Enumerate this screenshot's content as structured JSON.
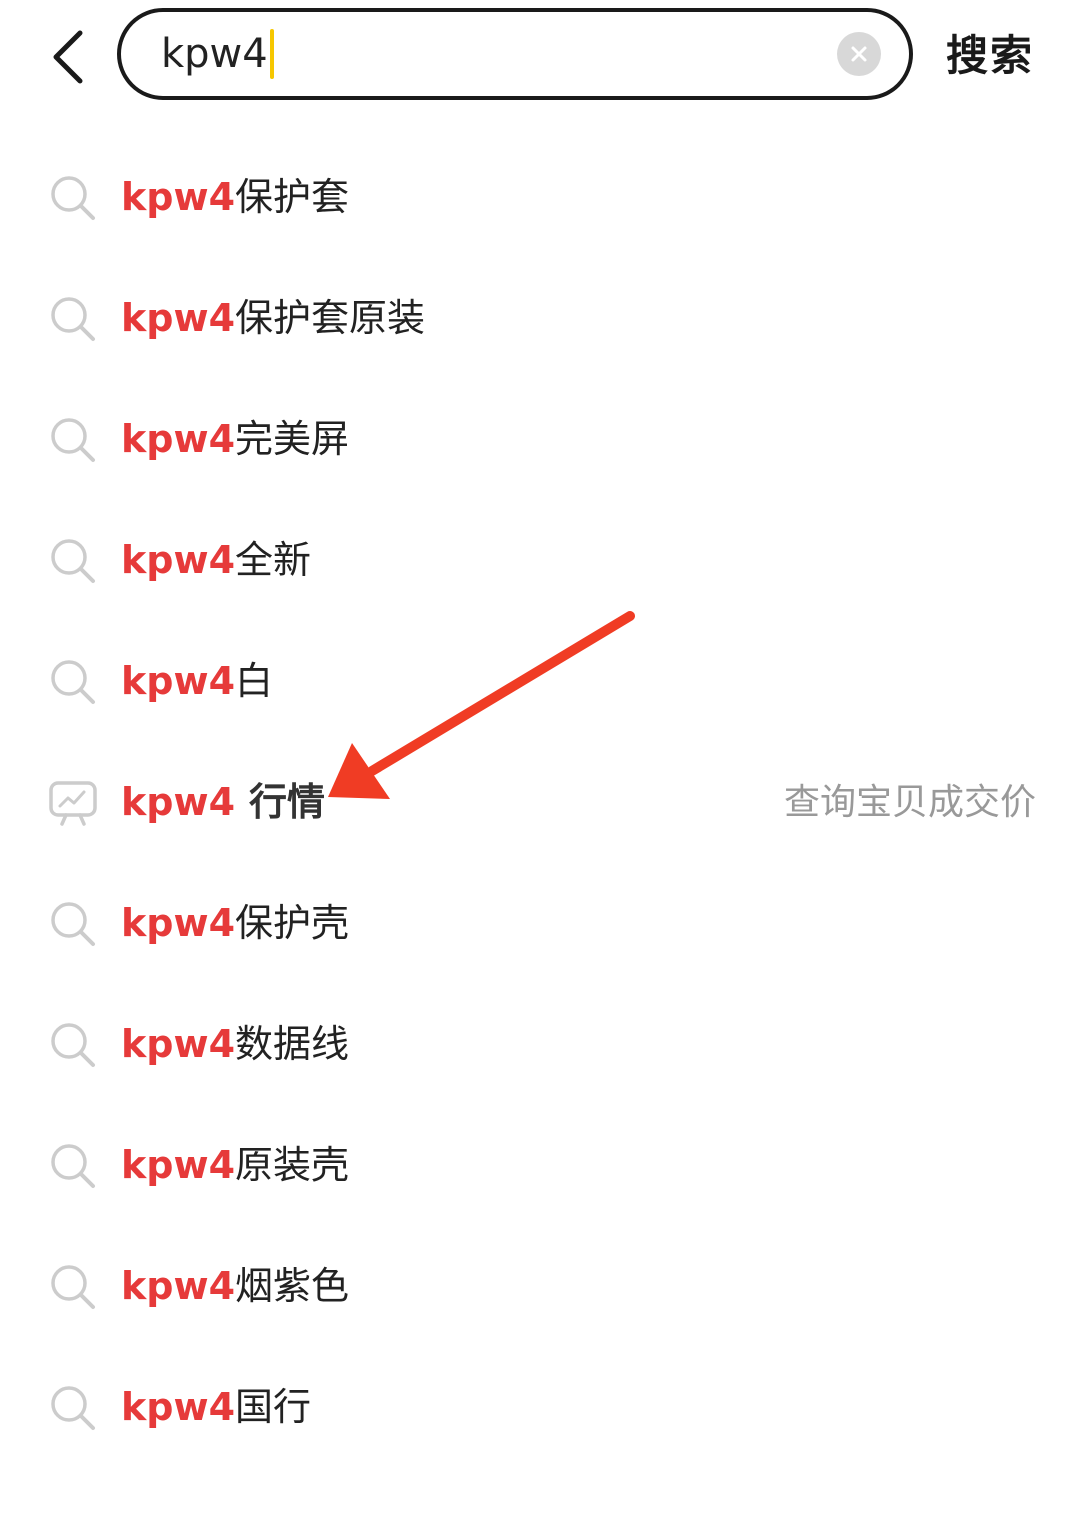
{
  "search": {
    "query": "kpw4",
    "submit_label": "搜索"
  },
  "suggestions": [
    {
      "prefix": "kpw4",
      "suffix": "保护套"
    },
    {
      "prefix": "kpw4",
      "suffix": "保护套原装"
    },
    {
      "prefix": "kpw4",
      "suffix": "完美屏"
    },
    {
      "prefix": "kpw4",
      "suffix": "全新"
    },
    {
      "prefix": "kpw4",
      "suffix": "白"
    },
    {
      "prefix": "kpw4",
      "suffix": "行情",
      "hint": "查询宝贝成交价"
    },
    {
      "prefix": "kpw4",
      "suffix": "保护壳"
    },
    {
      "prefix": "kpw4",
      "suffix": "数据线"
    },
    {
      "prefix": "kpw4",
      "suffix": "原装壳"
    },
    {
      "prefix": "kpw4",
      "suffix": "烟紫色"
    },
    {
      "prefix": "kpw4",
      "suffix": "国行"
    }
  ],
  "icons": {
    "back": "chevron-left-icon",
    "clear": "clear-icon",
    "suggestion": "search-icon",
    "market": "trend-chart-icon"
  },
  "colors": {
    "highlight": "#e63a3a",
    "caret": "#f6c700",
    "arrow": "#f03c24",
    "hint": "#999999"
  }
}
